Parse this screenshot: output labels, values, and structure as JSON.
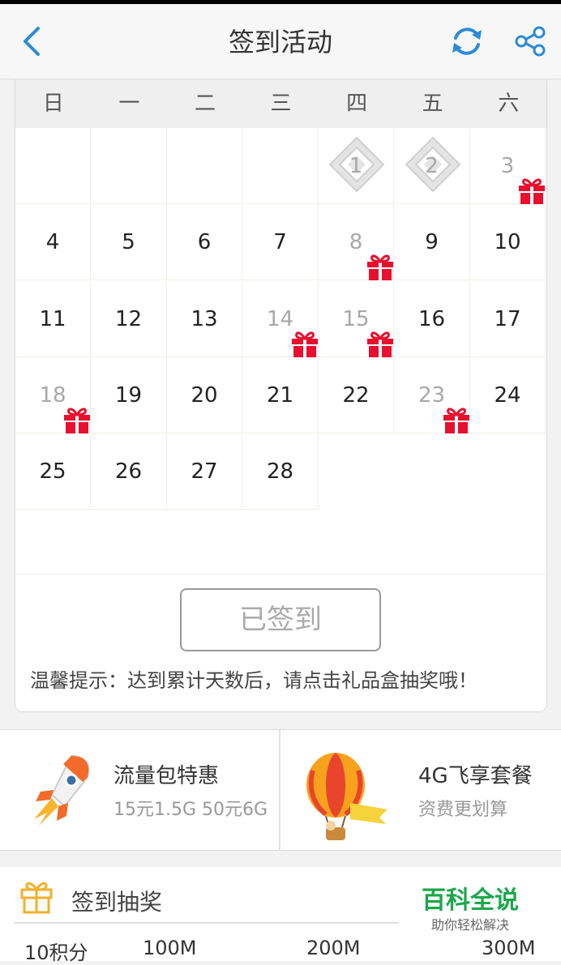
{
  "header": {
    "title": "签到活动"
  },
  "calendar": {
    "weekdays": [
      "日",
      "一",
      "二",
      "三",
      "四",
      "五",
      "六"
    ],
    "days": [
      {
        "label": "1",
        "state": "signed"
      },
      {
        "label": "2",
        "state": "signed"
      },
      {
        "label": "3",
        "state": "gift"
      },
      {
        "label": "4",
        "state": "normal"
      },
      {
        "label": "5",
        "state": "normal"
      },
      {
        "label": "6",
        "state": "normal"
      },
      {
        "label": "7",
        "state": "normal"
      },
      {
        "label": "8",
        "state": "gift"
      },
      {
        "label": "9",
        "state": "normal"
      },
      {
        "label": "10",
        "state": "normal"
      },
      {
        "label": "11",
        "state": "normal"
      },
      {
        "label": "12",
        "state": "normal"
      },
      {
        "label": "13",
        "state": "normal"
      },
      {
        "label": "14",
        "state": "gift"
      },
      {
        "label": "15",
        "state": "gift"
      },
      {
        "label": "16",
        "state": "normal"
      },
      {
        "label": "17",
        "state": "normal"
      },
      {
        "label": "18",
        "state": "gift"
      },
      {
        "label": "19",
        "state": "normal"
      },
      {
        "label": "20",
        "state": "normal"
      },
      {
        "label": "21",
        "state": "normal"
      },
      {
        "label": "22",
        "state": "normal"
      },
      {
        "label": "23",
        "state": "gift"
      },
      {
        "label": "24",
        "state": "normal"
      },
      {
        "label": "25",
        "state": "normal"
      },
      {
        "label": "26",
        "state": "normal"
      },
      {
        "label": "27",
        "state": "normal"
      },
      {
        "label": "28",
        "state": "normal"
      }
    ]
  },
  "signin": {
    "button_label": "已签到",
    "tip": "温馨提示：达到累计天数后，请点击礼品盒抽奖哦！"
  },
  "promos": [
    {
      "title": "流量包特惠",
      "subtitle": "15元1.5G 50元6G",
      "icon": "rocket-icon"
    },
    {
      "title": "4G飞享套餐",
      "subtitle": "资费更划算",
      "icon": "hot-air-balloon-icon"
    }
  ],
  "lottery": {
    "title": "签到抽奖",
    "levels": [
      "10积分",
      "100M",
      "200M",
      "300M"
    ]
  },
  "watermark": {
    "name": "百科全说",
    "slogan": "助你轻松解决"
  },
  "colors": {
    "accent": "#2b8ad8",
    "gift": "#e8102e",
    "watermark": "#1aa84b"
  }
}
